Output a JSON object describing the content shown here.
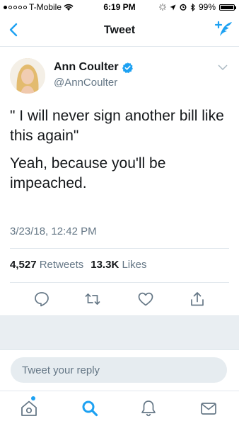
{
  "status_bar": {
    "carrier": "T-Mobile",
    "time": "6:19 PM",
    "battery": "99%",
    "battery_level": 0.99
  },
  "nav": {
    "title": "Tweet"
  },
  "tweet": {
    "author_name": "Ann Coulter",
    "author_handle": "@AnnCoulter",
    "text_line1": "\" I will never sign another bill like this again\"",
    "text_line2": "Yeah, because you'll be impeached.",
    "timestamp": "3/23/18, 12:42 PM",
    "retweets_count": "4,527",
    "retweets_label": "Retweets",
    "likes_count": "13.3K",
    "likes_label": "Likes"
  },
  "reply": {
    "placeholder": "Tweet your reply"
  },
  "colors": {
    "accent": "#1da1f2",
    "secondary_text": "#657786"
  },
  "icons": {
    "back": "chevron-left-icon",
    "compose": "compose-quill-icon",
    "verified": "verified-badge-icon",
    "reply": "reply-icon",
    "retweet": "retweet-icon",
    "like": "heart-icon",
    "share": "share-icon",
    "home": "home-icon",
    "search": "search-icon",
    "notifications": "bell-icon",
    "messages": "envelope-icon"
  }
}
